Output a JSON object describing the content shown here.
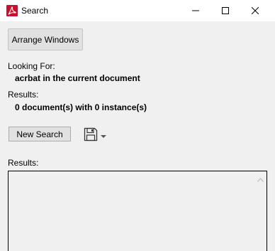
{
  "window": {
    "title": "Search",
    "app_icon": "acrobat-pdf-icon",
    "controls": [
      "minimize-icon",
      "maximize-icon",
      "close-icon"
    ]
  },
  "toolbar": {
    "arrange_label": "Arrange Windows"
  },
  "criteria": {
    "looking_for_label": "Looking For:",
    "looking_for_value": "acrbat in the current document",
    "results_label": "Results:",
    "results_value": "0 document(s) with 0 instance(s)"
  },
  "actions": {
    "new_search_label": "New Search",
    "save_icon": "floppy-disk-icon",
    "save_menu_icon": "chevron-down-icon"
  },
  "results_panel": {
    "label": "Results:"
  },
  "colors": {
    "acrobat_red": "#c8102e",
    "title_bg": "#ffffff",
    "window_bg": "#f0f0f0"
  }
}
